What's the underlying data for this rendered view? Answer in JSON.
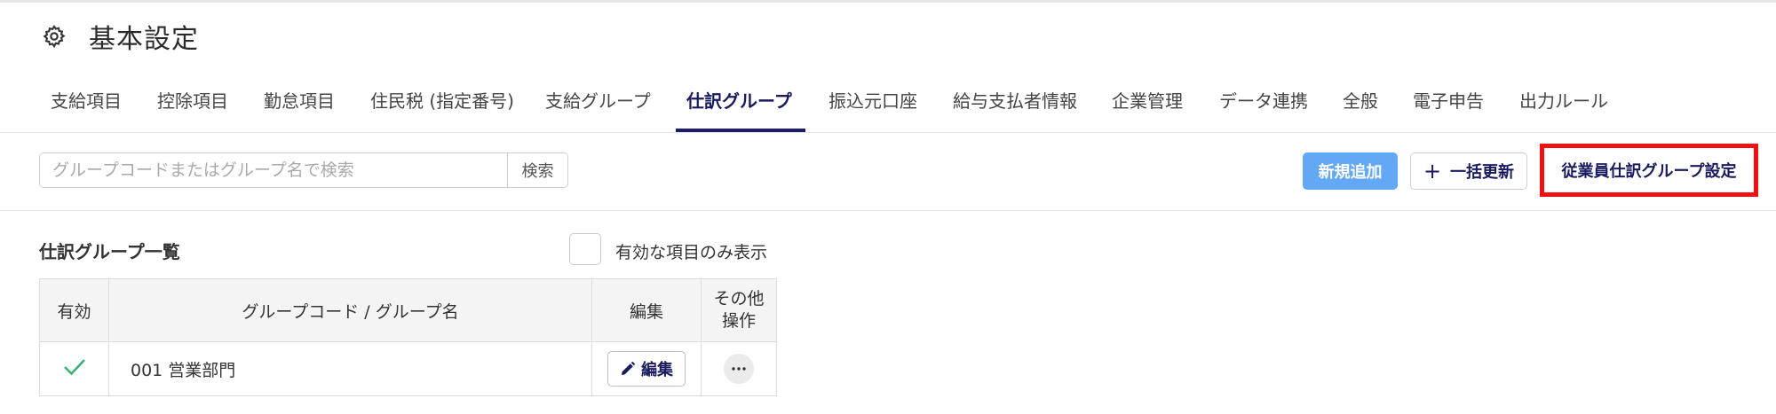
{
  "header": {
    "title": "基本設定",
    "icon": "gear-icon"
  },
  "tabs": [
    {
      "label": "支給項目"
    },
    {
      "label": "控除項目"
    },
    {
      "label": "勤怠項目"
    },
    {
      "label": "住民税 (指定番号)"
    },
    {
      "label": "支給グループ"
    },
    {
      "label": "仕訳グループ",
      "active": true
    },
    {
      "label": "振込元口座"
    },
    {
      "label": "給与支払者情報"
    },
    {
      "label": "企業管理"
    },
    {
      "label": "データ連携"
    },
    {
      "label": "全般"
    },
    {
      "label": "電子申告"
    },
    {
      "label": "出力ルール"
    }
  ],
  "toolbar": {
    "search_placeholder": "グループコードまたはグループ名で検索",
    "search_value": "",
    "search_button": "検索",
    "new_button": "新規追加",
    "bulk_update_button": "一括更新",
    "employee_group_settings_button": "従業員仕訳グループ設定"
  },
  "list": {
    "title": "仕訳グループ一覧",
    "filter_label": "有効な項目のみ表示",
    "filter_checked": false,
    "columns": {
      "enabled": "有効",
      "code_name": "グループコード / グループ名",
      "edit": "編集",
      "other_line1": "その他",
      "other_line2": "操作"
    },
    "rows": [
      {
        "enabled": true,
        "code_name": "001 営業部門",
        "edit_label": "編集"
      }
    ]
  },
  "colors": {
    "accent_navy": "#1a1a5e",
    "primary_button": "#62a8f4",
    "highlight_red": "#ee1111",
    "check_green": "#3bb273"
  }
}
